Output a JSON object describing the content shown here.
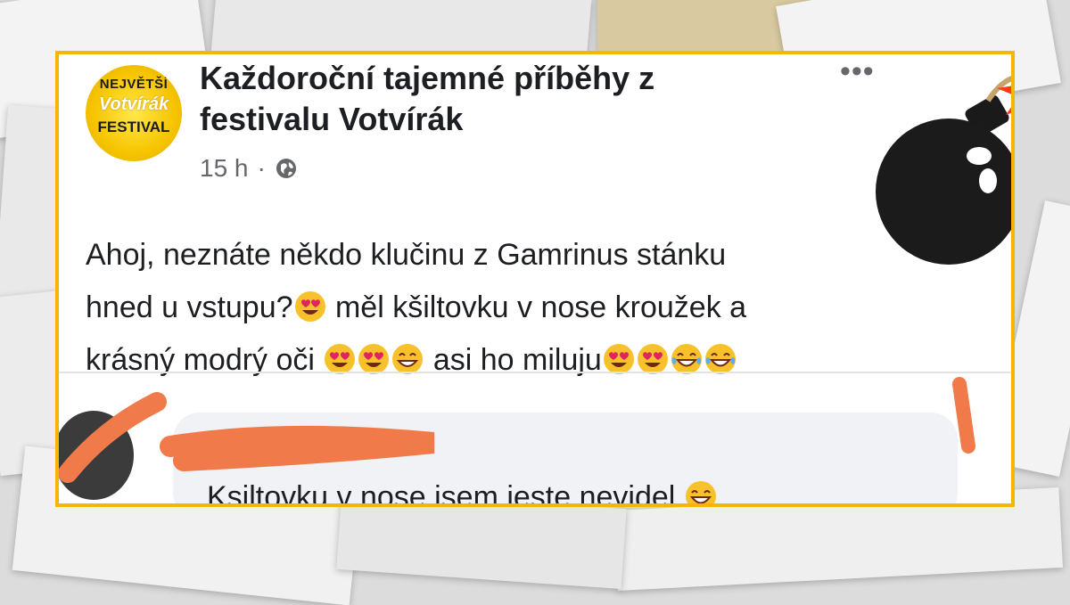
{
  "post": {
    "page_name": "Každoroční tajemné příběhy z festivalu Votvírák",
    "timestamp": "15 h",
    "separator": "·",
    "more_label": "•••",
    "body_line1": "Ahoj, neznáte někdo klučinu z Gamrinus stánku",
    "body_line2a": "hned u vstupu?",
    "body_line2b": " měl kšiltovku v nose kroužek a",
    "body_line3a": "krásný modrý oči ",
    "body_line3b": " asi ho miluju"
  },
  "logo": {
    "line1": "NEJVĚTŠÍ",
    "line2": "Votvírák",
    "line3": "FESTIVAL"
  },
  "comment": {
    "text": "Ksiltovku v nose jsem jeste nevidel"
  },
  "icons": {
    "heart_eyes": "heart-eyes-emoji",
    "grin": "grinning-emoji",
    "joy": "tears-of-joy-emoji",
    "globe": "globe-icon",
    "bomb": "bomb-icon"
  },
  "colors": {
    "frame_border": "#f7b500",
    "scribble": "#f07a4a",
    "text": "#1c1e21",
    "meta": "#65676b"
  }
}
